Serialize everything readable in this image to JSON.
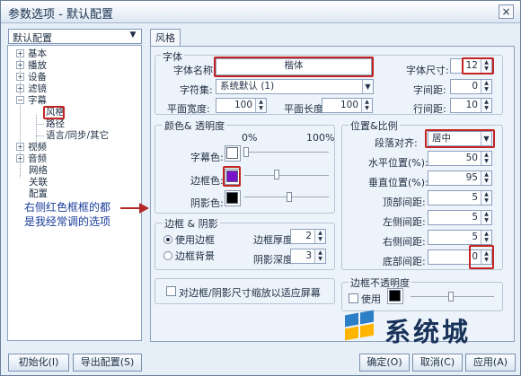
{
  "window": {
    "title": "参数选项 - 默认配置",
    "close": "×"
  },
  "profile": {
    "selected": "默认配置"
  },
  "tree": [
    {
      "label": "基本",
      "expand": "+"
    },
    {
      "label": "播放",
      "expand": "+"
    },
    {
      "label": "设备",
      "expand": "+"
    },
    {
      "label": "滤镜",
      "expand": "+"
    },
    {
      "label": "字幕",
      "expand": "−"
    },
    {
      "label": "风格"
    },
    {
      "label": "路径"
    },
    {
      "label": "语言/同步/其它"
    },
    {
      "label": "视频",
      "expand": "+"
    },
    {
      "label": "音频",
      "expand": "+"
    },
    {
      "label": "网络"
    },
    {
      "label": "关联"
    },
    {
      "label": "配置"
    }
  ],
  "annotation": {
    "line1": "右侧红色框框的都",
    "line2": "是我经常调的选项"
  },
  "tab": {
    "label": "风格"
  },
  "font": {
    "group": "字体",
    "name_label": "字体名称:",
    "name_value": "楷体",
    "charset_label": "字符集:",
    "charset_value": "系统默认 (1)",
    "width_label": "平面宽度:",
    "width_value": "100",
    "length_label": "平面长度:",
    "length_value": "100",
    "size_label": "字体尺寸:",
    "size_value": "12",
    "char_spacing_label": "字间距:",
    "char_spacing_value": "0",
    "line_spacing_label": "行间距:",
    "line_spacing_value": "10"
  },
  "colors": {
    "group": "颜色& 透明度",
    "pct0": "0%",
    "pct100": "100%",
    "subtitle_label": "字幕色:",
    "subtitle_color": "#ffffff",
    "border_label": "边框色:",
    "border_color": "#7a12c8",
    "shadow_label": "阴影色:",
    "shadow_color": "#000000"
  },
  "border": {
    "group": "边框 & 阴影",
    "use_border": "使用边框",
    "border_bg": "边框背景",
    "thickness_label": "边框厚度:",
    "thickness_value": "2",
    "shadow_depth_label": "阴影深度:",
    "shadow_depth_value": "3",
    "scale_checkbox": "对边框/阴影尺寸缩放以适应屏幕"
  },
  "position": {
    "group": "位置&比例",
    "align_label": "段落对齐:",
    "align_value": "居中",
    "h_label": "水平位置(%):",
    "h_value": "50",
    "v_label": "垂直位置(%):",
    "v_value": "95",
    "top_label": "顶部间距:",
    "top_value": "5",
    "left_label": "左侧间距:",
    "left_value": "5",
    "right_label": "右侧间距:",
    "right_value": "5",
    "bottom_label": "底部间距:",
    "bottom_value": "0"
  },
  "opacity": {
    "group": "边框不透明度",
    "use": "使用"
  },
  "buttons": {
    "init": "初始化(I)",
    "export": "导出配置(S)",
    "ok": "确定(O)",
    "cancel": "取消(C)",
    "apply": "应用(A)"
  },
  "watermark": "系统城"
}
